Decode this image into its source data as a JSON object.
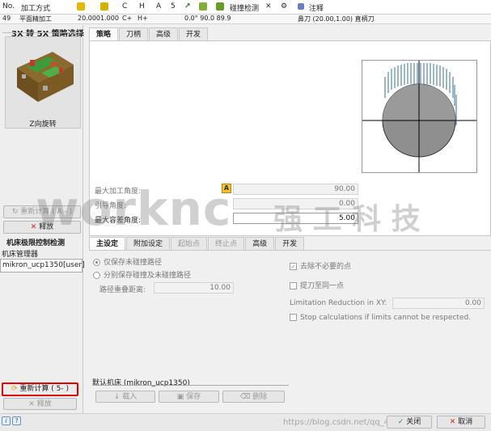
{
  "header": {
    "no": "No.",
    "op_type": "加工方式",
    "col_c": "C",
    "col_h": "H",
    "col_a": "A",
    "col_5": "5",
    "collision": "碰撞检测",
    "note": "注释"
  },
  "row": {
    "id": "49",
    "name": "平面精加工",
    "val1": "20.000",
    "val2": "1.000",
    "val3": "C+",
    "val4": "H+",
    "angles": "0.0°  90.0  89.9",
    "tool": "鼻刀 (20.00,1.00) 直柄刀"
  },
  "left": {
    "group_title": "3X 转 5X 策略选择",
    "tile_label": "Z向旋转",
    "recalc_a": "重新计算 ( A - )",
    "release_1": "释放",
    "machine_limit_title": "机床极限控制检测",
    "machine_mgr": "机床管理器",
    "machine_value": "mikron_ucp1350[user]",
    "recalc_5": "重新计算 ( 5- )",
    "release_2": "释放"
  },
  "top_tabs": [
    "策略",
    "刀柄",
    "高级",
    "开发"
  ],
  "angles": {
    "max_angle_label": "最大加工角度:",
    "max_angle_value": "90.00",
    "lead_angle_label": "引导角度:",
    "lead_angle_value": "0.00",
    "max_tol_label": "最大容差角度:",
    "max_tol_value": "5.00",
    "badge": "A"
  },
  "bottom_tabs": [
    "主设定",
    "附加设定",
    "起始点",
    "终止点",
    "高级",
    "开发"
  ],
  "settings": {
    "radio_1": "仅保存未碰撞路径",
    "radio_2": "分别保存碰撞及未碰撞路径",
    "overlap_label": "路径重叠距离:",
    "overlap_value": "10.00",
    "chk_remove": "去除不必要的点",
    "chk_lift": "提刀至同一点",
    "limit_label": "Limitation Reduction in XY:",
    "limit_value": "0.00",
    "chk_stop": "Stop calculations if limits cannot be respected."
  },
  "default_machine": {
    "title": "默认机床 (mikron_ucp1350)",
    "load": "载入",
    "save": "保存",
    "delete": "删除"
  },
  "footer": {
    "close": "关闭",
    "cancel": "取消",
    "watermark_url": "https://blog.csdn.net/qq_41294740"
  },
  "watermark": {
    "brand": "worknc",
    "cn": "强 工 科 技"
  },
  "colors": {
    "highlight_border": "#e00000",
    "badge_yellow": "#f2c230"
  }
}
